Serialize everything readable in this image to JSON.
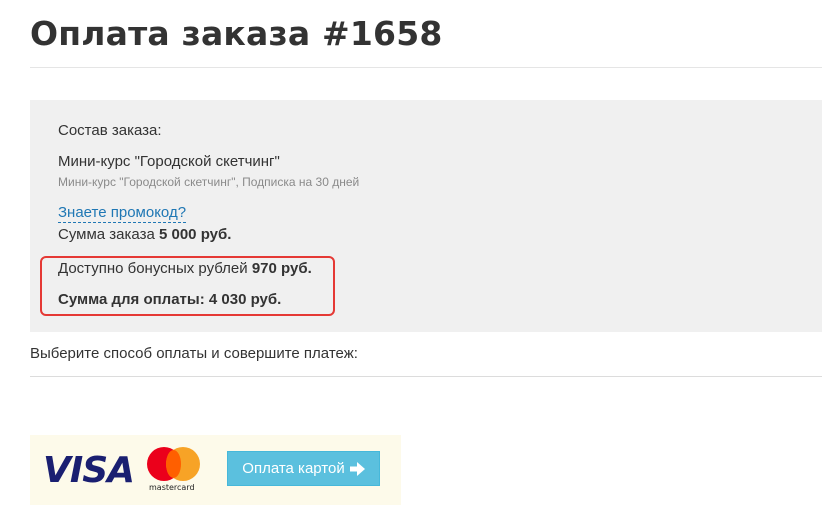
{
  "header": {
    "title": "Оплата заказа #1658"
  },
  "order": {
    "composition_label": "Состав заказа:",
    "item_name": "Мини-курс \"Городской скетчинг\"",
    "item_details": "Мини-курс \"Городской скетчинг\", Подписка на 30 дней",
    "promo_link": "Знаете промокод?",
    "total_label": "Сумма заказа",
    "total_value": "5 000 руб.",
    "bonus_label": "Доступно бонусных рублей",
    "bonus_value": "970 руб.",
    "pay_total_label": "Сумма для оплаты:",
    "pay_total_value": "4 030 руб."
  },
  "payment": {
    "instruction": "Выберите способ оплаты и совершите платеж:",
    "visa_logo": "VISA",
    "mastercard_logo": "mastercard",
    "pay_button": "Оплата картой"
  },
  "colors": {
    "highlight_border": "#e53935",
    "button_bg": "#5bc0de",
    "link": "#1f77b4",
    "summary_bg": "#f0f0f0",
    "payment_panel_bg": "#fdfaea"
  },
  "icons": {
    "pay_button_icon": "arrow-right-icon"
  }
}
